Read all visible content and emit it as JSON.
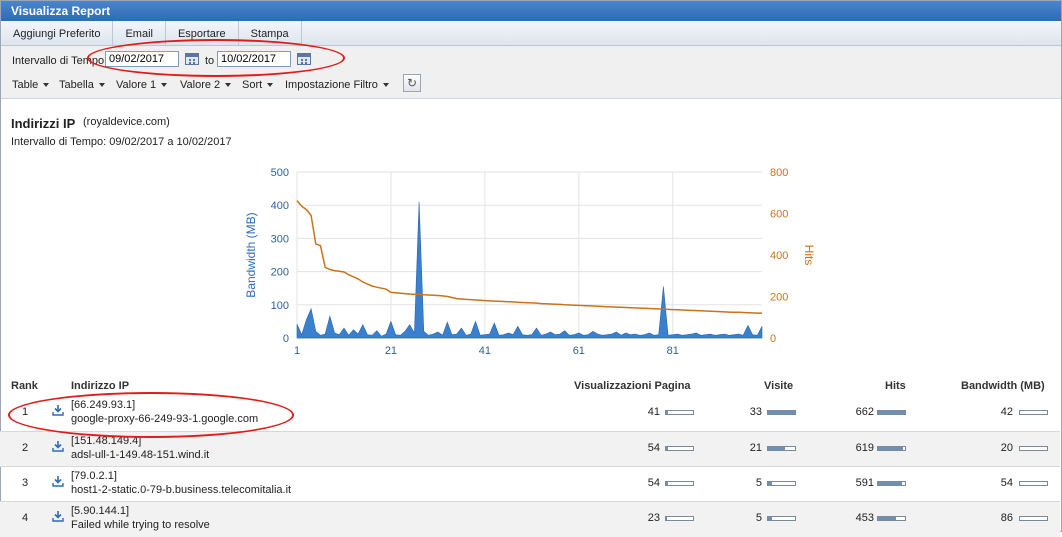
{
  "window": {
    "title": "Visualizza Report"
  },
  "menu": [
    "Aggiungi Preferito",
    "Email",
    "Esportare",
    "Stampa"
  ],
  "datebar": {
    "label": "Intervallo di Tempo",
    "from": "09/02/2017",
    "to_label": "to",
    "to": "10/02/2017"
  },
  "toolbar": [
    "Table",
    "Tabella",
    "Valore 1",
    "Valore 2",
    "Sort",
    "Impostazione Filtro"
  ],
  "report": {
    "title": "Indirizzi IP",
    "domain": "(royaldevice.com)",
    "range_label": "Intervallo di Tempo:  09/02/2017 a 10/02/2017"
  },
  "chart_data": {
    "type": "area",
    "ylabel": "Bandwidth (MB)",
    "y2label": "Hits",
    "x_ticks": [
      "1",
      "21",
      "41",
      "61",
      "81"
    ],
    "y_ticks": [
      "0",
      "100",
      "200",
      "300",
      "400",
      "500"
    ],
    "y2_ticks": [
      "0",
      "200",
      "400",
      "600",
      "800"
    ],
    "xlim": [
      1,
      100
    ],
    "ylim": [
      0,
      500
    ],
    "y2lim": [
      0,
      800
    ],
    "series": [
      {
        "axis": "left",
        "color": "#3b7fcf",
        "x": [
          1,
          2,
          3,
          4,
          5,
          6,
          7,
          8,
          9,
          10,
          11,
          12,
          13,
          14,
          15,
          16,
          17,
          18,
          19,
          20,
          21,
          22,
          23,
          24,
          25,
          26,
          27,
          28,
          29,
          30,
          31,
          32,
          33,
          34,
          35,
          36,
          37,
          38,
          39,
          40,
          41,
          42,
          43,
          44,
          45,
          46,
          47,
          48,
          49,
          50,
          51,
          52,
          53,
          54,
          55,
          56,
          57,
          58,
          59,
          60,
          61,
          62,
          63,
          64,
          65,
          66,
          67,
          68,
          69,
          70,
          71,
          72,
          73,
          74,
          75,
          76,
          77,
          78,
          79,
          80,
          81,
          82,
          83,
          84,
          85,
          86,
          87,
          88,
          89,
          90,
          91,
          92,
          93,
          94,
          95,
          96,
          97,
          98,
          99,
          100
        ],
        "values": [
          42,
          10,
          55,
          88,
          20,
          8,
          12,
          66,
          15,
          10,
          30,
          8,
          25,
          12,
          40,
          10,
          8,
          22,
          5,
          12,
          50,
          10,
          8,
          20,
          40,
          15,
          410,
          20,
          8,
          12,
          18,
          8,
          48,
          10,
          12,
          30,
          8,
          12,
          50,
          8,
          10,
          12,
          45,
          8,
          10,
          15,
          10,
          35,
          10,
          8,
          10,
          30,
          8,
          12,
          18,
          10,
          12,
          22,
          8,
          10,
          15,
          8,
          10,
          20,
          12,
          8,
          10,
          12,
          18,
          8,
          15,
          10,
          12,
          8,
          10,
          15,
          8,
          10,
          155,
          8,
          10,
          12,
          8,
          10,
          12,
          15,
          8,
          10,
          12,
          8,
          10,
          12,
          8,
          10,
          12,
          8,
          38,
          10,
          8,
          35
        ]
      },
      {
        "axis": "right",
        "color": "#c8741b",
        "x": [
          1,
          2,
          3,
          4,
          5,
          6,
          7,
          8,
          9,
          10,
          11,
          12,
          13,
          14,
          15,
          16,
          17,
          18,
          19,
          20,
          21,
          22,
          23,
          24,
          25,
          26,
          27,
          28,
          29,
          30,
          31,
          32,
          33,
          34,
          35,
          36,
          37,
          38,
          39,
          40,
          41,
          42,
          43,
          44,
          45,
          46,
          47,
          48,
          49,
          50,
          51,
          52,
          53,
          54,
          55,
          56,
          57,
          58,
          59,
          60,
          61,
          62,
          63,
          64,
          65,
          66,
          67,
          68,
          69,
          70,
          71,
          72,
          73,
          74,
          75,
          76,
          77,
          78,
          79,
          80,
          81,
          82,
          83,
          84,
          85,
          86,
          87,
          88,
          89,
          90,
          91,
          92,
          93,
          94,
          95,
          96,
          97,
          98,
          99,
          100
        ],
        "values": [
          662,
          635,
          619,
          591,
          453,
          445,
          340,
          330,
          325,
          322,
          318,
          305,
          295,
          285,
          270,
          260,
          250,
          245,
          240,
          235,
          220,
          218,
          216,
          214,
          212,
          210,
          210,
          208,
          207,
          206,
          205,
          203,
          200,
          195,
          190,
          188,
          186,
          185,
          183,
          182,
          180,
          179,
          178,
          177,
          176,
          175,
          174,
          172,
          171,
          170,
          169,
          168,
          166,
          165,
          164,
          163,
          162,
          160,
          159,
          158,
          157,
          156,
          155,
          154,
          153,
          152,
          151,
          150,
          149,
          148,
          147,
          146,
          145,
          144,
          143,
          142,
          141,
          140,
          139,
          138,
          137,
          136,
          135,
          134,
          133,
          132,
          131,
          130,
          129,
          128,
          127,
          126,
          125,
          124,
          124,
          123,
          122,
          121,
          120,
          120
        ]
      }
    ]
  },
  "table": {
    "headers": {
      "rank": "Rank",
      "ip": "Indirizzo IP",
      "pages": "Visualizzazioni Pagina",
      "visits": "Visite",
      "hits": "Hits",
      "bandwidth": "Bandwidth (MB)"
    },
    "rows": [
      {
        "rank": "1",
        "ip": "[66.249.93.1]",
        "host": "google-proxy-66-249-93-1.google.com",
        "pages": "41",
        "pages_frac": 0.06,
        "visits": "33",
        "visits_frac": 1.0,
        "hits": "662",
        "hits_frac": 1.0,
        "bandwidth": "42",
        "bw_frac": 0.0
      },
      {
        "rank": "2",
        "ip": "[151.48.149.4]",
        "host": "adsl-ull-1-149.48-151.wind.it",
        "pages": "54",
        "pages_frac": 0.06,
        "visits": "21",
        "visits_frac": 0.64,
        "hits": "619",
        "hits_frac": 0.94,
        "bandwidth": "20",
        "bw_frac": 0.0
      },
      {
        "rank": "3",
        "ip": "[79.0.2.1]",
        "host": "host1-2-static.0-79-b.business.telecomitalia.it",
        "pages": "54",
        "pages_frac": 0.06,
        "visits": "5",
        "visits_frac": 0.15,
        "hits": "591",
        "hits_frac": 0.9,
        "bandwidth": "54",
        "bw_frac": 0.0
      },
      {
        "rank": "4",
        "ip": "[5.90.144.1]",
        "host": "Failed while trying to resolve",
        "pages": "23",
        "pages_frac": 0.03,
        "visits": "5",
        "visits_frac": 0.15,
        "hits": "453",
        "hits_frac": 0.68,
        "bandwidth": "86",
        "bw_frac": 0.0
      }
    ]
  },
  "colors": {
    "titlebar": "#2f6bb3",
    "annotation": "#e01b1b",
    "area": "#3b7fcf",
    "hits_line": "#c8741b"
  }
}
